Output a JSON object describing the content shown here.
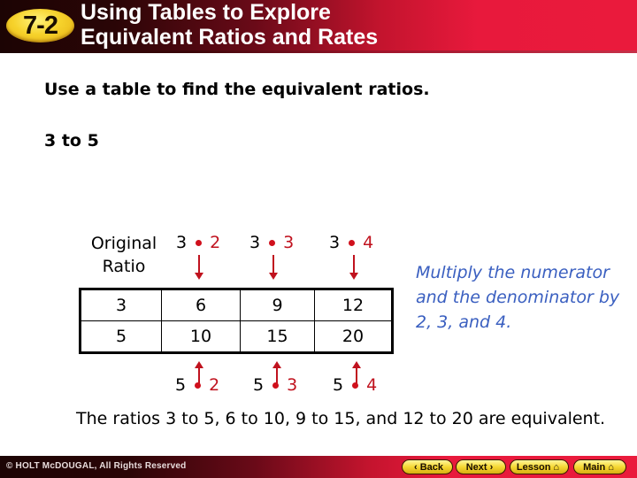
{
  "header": {
    "badge": "7-2",
    "title_line1": "Using Tables to Explore",
    "title_line2": "Equivalent Ratios and Rates"
  },
  "instruction": "Use a table to find the equivalent ratios.",
  "problem": "3 to 5",
  "original_ratio_label": "Original Ratio",
  "multipliers_top": [
    {
      "base": "3",
      "factor": "2"
    },
    {
      "base": "3",
      "factor": "3"
    },
    {
      "base": "3",
      "factor": "4"
    }
  ],
  "multipliers_bottom": [
    {
      "base": "5",
      "factor": "2"
    },
    {
      "base": "5",
      "factor": "3"
    },
    {
      "base": "5",
      "factor": "4"
    }
  ],
  "table": {
    "rows": [
      [
        "3",
        "6",
        "9",
        "12"
      ],
      [
        "5",
        "10",
        "15",
        "20"
      ]
    ]
  },
  "note": "Multiply the numerator and the denominator by 2, 3, and 4.",
  "conclusion": "The ratios 3 to 5, 6 to 10, 9 to 15, and 12 to 20 are equivalent.",
  "footer": {
    "copyright": "© HOLT McDOUGAL, All Rights Reserved",
    "buttons": {
      "back": {
        "label": "Back",
        "icon": "‹"
      },
      "next": {
        "label": "Next",
        "icon": "›"
      },
      "lesson": {
        "label": "Lesson",
        "icon": "⌂"
      },
      "main": {
        "label": "Main",
        "icon": "⌂"
      }
    }
  },
  "colors": {
    "accent_red": "#e8193c",
    "multiplier_red": "#c0121e",
    "note_blue": "#3a5fc0",
    "badge_yellow": "#f6d22b"
  }
}
